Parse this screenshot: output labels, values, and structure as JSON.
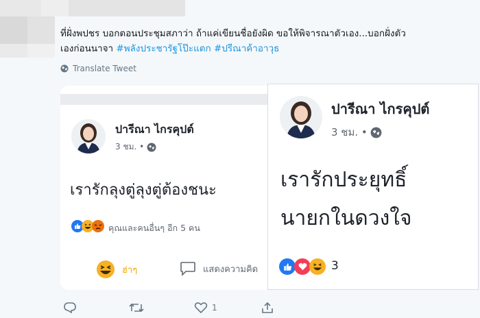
{
  "tweet": {
    "text_line1": "ที่ฝั่งพปชร บอกตอนประชุมสภาว่า ถ้าแค่เขียนชื่อยังผิด ขอให้พิจารณาตัวเอง...บอกฝั่งตัว",
    "text_line2_prefix": "เองก่อนนาจา ",
    "hashtags": [
      "#พลังประชารัฐโป๊ะแตก",
      "#ปรีณาค้าอาวุธ"
    ],
    "translate_label": "Translate Tweet"
  },
  "card_left": {
    "name": "ปารีณา ไกรคุปต์",
    "meta": "3 ชม. •",
    "post_text": "เรารักลุงตู่ลุงตู่ต้องชนะ",
    "reactions_text": "คุณและคนอื่นๆ อีก 5 คน",
    "action_laugh": "ฮ่าๆ",
    "action_comment": "แสดงความคิด"
  },
  "card_right": {
    "name": "ปารีณา ไกรคุปต์",
    "meta": "3 ชม. •",
    "post_line1": "เรารักประยุทธิ์",
    "post_line2": "นายกในดวงใจ",
    "reaction_count": "3"
  },
  "footer": {
    "reply_count": "",
    "retweet_count": "",
    "like_count": "1"
  },
  "colors": {
    "link": "#1b95e0",
    "like": "#2078f4",
    "love": "#f33e58",
    "haha": "#f7b125",
    "angry": "#e9710f"
  }
}
